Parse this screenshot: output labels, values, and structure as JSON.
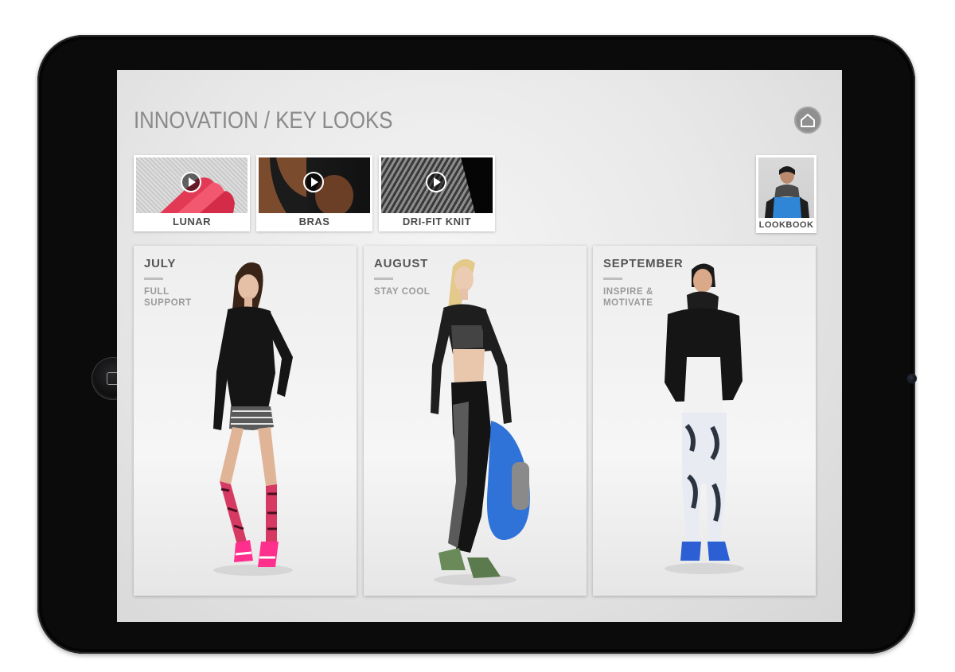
{
  "header": {
    "title": "INNOVATION / KEY LOOKS",
    "home_icon": "home-icon"
  },
  "videos": [
    {
      "label": "LUNAR",
      "icon": "play-icon"
    },
    {
      "label": "BRAS",
      "icon": "play-icon"
    },
    {
      "label": "DRI-FIT KNIT",
      "icon": "play-icon"
    }
  ],
  "lookbook": {
    "label": "LOOKBOOK"
  },
  "months": [
    {
      "name": "JULY",
      "theme": "FULL SUPPORT"
    },
    {
      "name": "AUGUST",
      "theme": "STAY COOL"
    },
    {
      "name": "SEPTEMBER",
      "theme": "INSPIRE & MOTIVATE"
    }
  ],
  "colors": {
    "device": "#0b0b0c",
    "screen_bg": "#e9e9e9",
    "title": "#8a8a8a",
    "accent_pink": "#e8365a",
    "accent_blue": "#3a7bd5"
  }
}
